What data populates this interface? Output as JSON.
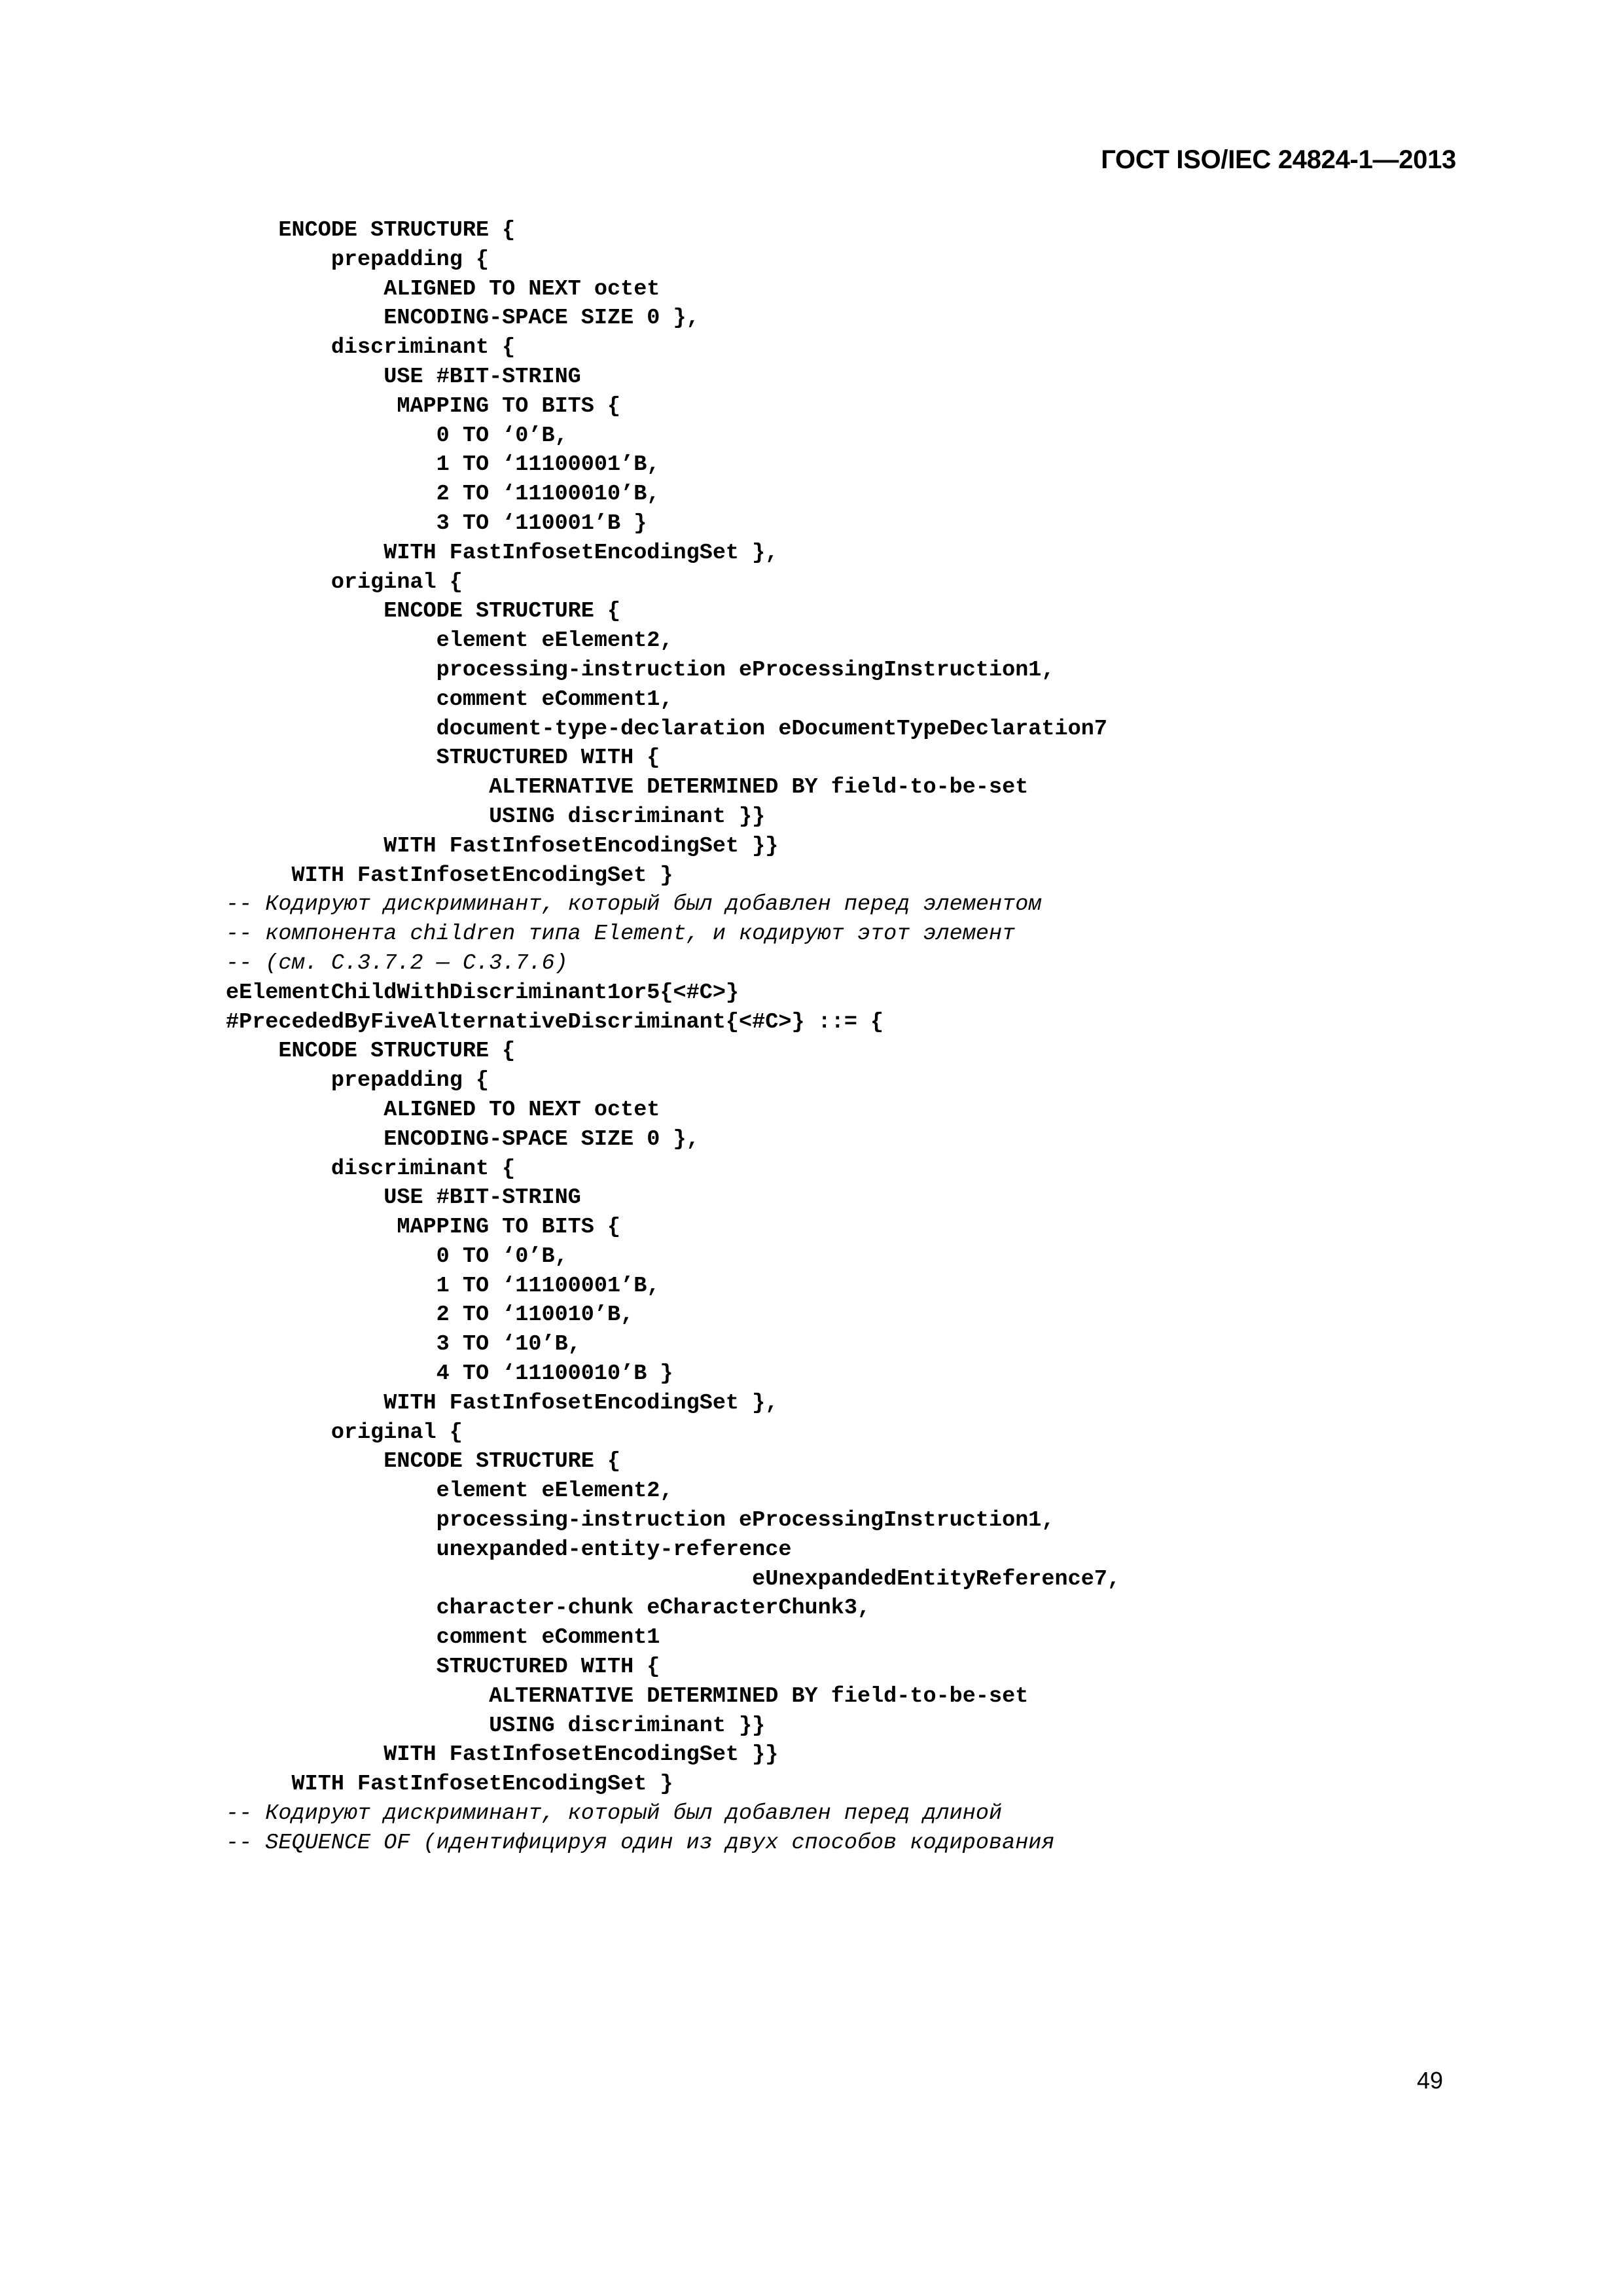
{
  "document": {
    "standard_header": "ГОСТ ISO/IEC 24824-1—2013",
    "page_number": "49",
    "language": "ru"
  },
  "code_block": {
    "language": "ASN.1 / ECN encoding notation",
    "lines": [
      "    ENCODE STRUCTURE {",
      "        prepadding {",
      "            ALIGNED TO NEXT octet",
      "            ENCODING-SPACE SIZE 0 },",
      "        discriminant {",
      "            USE #BIT-STRING",
      "             MAPPING TO BITS {",
      "                0 TO ‘0’B,",
      "                1 TO ‘11100001’B,",
      "                2 TO ‘11100010’B,",
      "                3 TO ‘110001’B }",
      "            WITH FastInfosetEncodingSet },",
      "        original {",
      "            ENCODE STRUCTURE {",
      "                element eElement2,",
      "                processing-instruction eProcessingInstruction1,",
      "                comment eComment1,",
      "                document-type-declaration eDocumentTypeDeclaration7",
      "                STRUCTURED WITH {",
      "                    ALTERNATIVE DETERMINED BY field-to-be-set",
      "                    USING discriminant }}",
      "            WITH FastInfosetEncodingSet }}",
      "     WITH FastInfosetEncodingSet }"
    ]
  },
  "comment_block_1": {
    "lines": [
      "-- Кодируют дискриминант, который был добавлен перед элементом",
      "-- компонента children типа Element, и кодируют этот элемент",
      "-- (см. C.3.7.2 — C.3.7.6)"
    ]
  },
  "definition_header": {
    "lines": [
      "eElementChildWithDiscriminant1or5{<#C>}",
      "#PrecededByFiveAlternativeDiscriminant{<#C>} ::= {"
    ]
  },
  "code_block_2": {
    "language": "ASN.1 / ECN encoding notation",
    "lines": [
      "    ENCODE STRUCTURE {",
      "        prepadding {",
      "            ALIGNED TO NEXT octet",
      "            ENCODING-SPACE SIZE 0 },",
      "        discriminant {",
      "            USE #BIT-STRING",
      "             MAPPING TO BITS {",
      "                0 TO ‘0’B,",
      "                1 TO ‘11100001’B,",
      "                2 TO ‘110010’B,",
      "                3 TO ‘10’B,",
      "                4 TO ‘11100010’B }",
      "            WITH FastInfosetEncodingSet },",
      "        original {",
      "            ENCODE STRUCTURE {",
      "                element eElement2,",
      "                processing-instruction eProcessingInstruction1,",
      "                unexpanded-entity-reference",
      "                                        eUnexpandedEntityReference7,",
      "                character-chunk eCharacterChunk3,",
      "                comment eComment1",
      "                STRUCTURED WITH {",
      "                    ALTERNATIVE DETERMINED BY field-to-be-set",
      "                    USING discriminant }}",
      "            WITH FastInfosetEncodingSet }}",
      "     WITH FastInfosetEncodingSet }"
    ]
  },
  "comment_block_2": {
    "lines": [
      "-- Кодируют дискриминант, который был добавлен перед длиной",
      "-- SEQUENCE OF (идентифицируя один из двух способов кодирования"
    ]
  },
  "bit_mappings": {
    "block_1": [
      {
        "index": "0",
        "bits": "‘0’B"
      },
      {
        "index": "1",
        "bits": "‘11100001’B"
      },
      {
        "index": "2",
        "bits": "‘11100010’B"
      },
      {
        "index": "3",
        "bits": "‘110001’B"
      }
    ],
    "block_2": [
      {
        "index": "0",
        "bits": "‘0’B"
      },
      {
        "index": "1",
        "bits": "‘11100001’B"
      },
      {
        "index": "2",
        "bits": "‘110010’B"
      },
      {
        "index": "3",
        "bits": "‘10’B"
      },
      {
        "index": "4",
        "bits": "‘11100010’B"
      }
    ]
  }
}
